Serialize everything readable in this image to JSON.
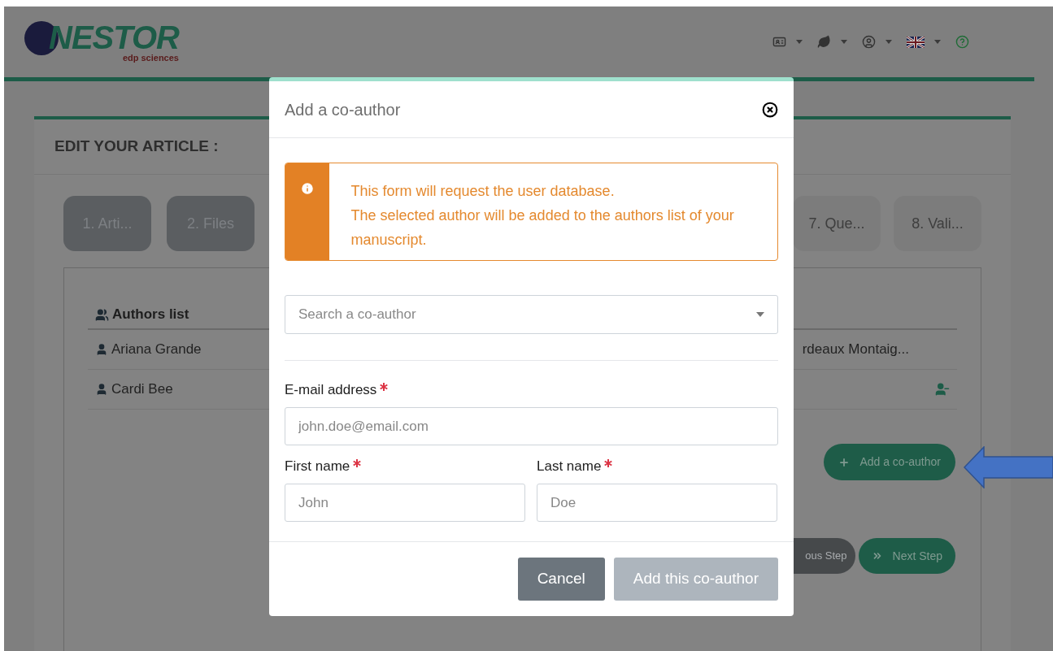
{
  "header": {
    "logo": {
      "name": "NESTOR",
      "tagline": "edp sciences"
    },
    "menus": [
      {
        "kind": "card"
      },
      {
        "kind": "leaf"
      },
      {
        "kind": "user"
      },
      {
        "kind": "flag"
      },
      {
        "kind": "help"
      }
    ]
  },
  "article": {
    "title": "EDIT YOUR ARTICLE :",
    "steps_left": [
      {
        "label": "1. Arti...",
        "disabled": false
      },
      {
        "label": "2. Files",
        "disabled": false
      }
    ],
    "steps_right": [
      {
        "label": "7. Que...",
        "disabled": true
      },
      {
        "label": "8. Vali...",
        "disabled": true
      }
    ],
    "authors_heading": "Authors list",
    "authors": [
      {
        "name": "Ariana Grande",
        "column_2": "rdeaux Montaig...",
        "removable": false
      },
      {
        "name": "Cardi Bee",
        "removable": true
      }
    ],
    "add_button": "Add a co-author",
    "previous_button": "ous Step",
    "next_button": "Next Step"
  },
  "modal": {
    "title": "Add a co-author",
    "alert": [
      "This form will request the user database.",
      "The selected author will be added to the authors list of your manuscript."
    ],
    "search": {
      "placeholder": "Search a co-author"
    },
    "fields": [
      {
        "label": "E-mail address",
        "placeholder": "john.doe@email.com",
        "required": true
      },
      {
        "label": "First name",
        "placeholder": "John",
        "required": true
      },
      {
        "label": "Last name",
        "placeholder": "Doe",
        "required": true
      }
    ],
    "buttons": [
      {
        "label": "Cancel",
        "disabled": false
      },
      {
        "label": "Add this co-author",
        "disabled": true
      }
    ]
  }
}
